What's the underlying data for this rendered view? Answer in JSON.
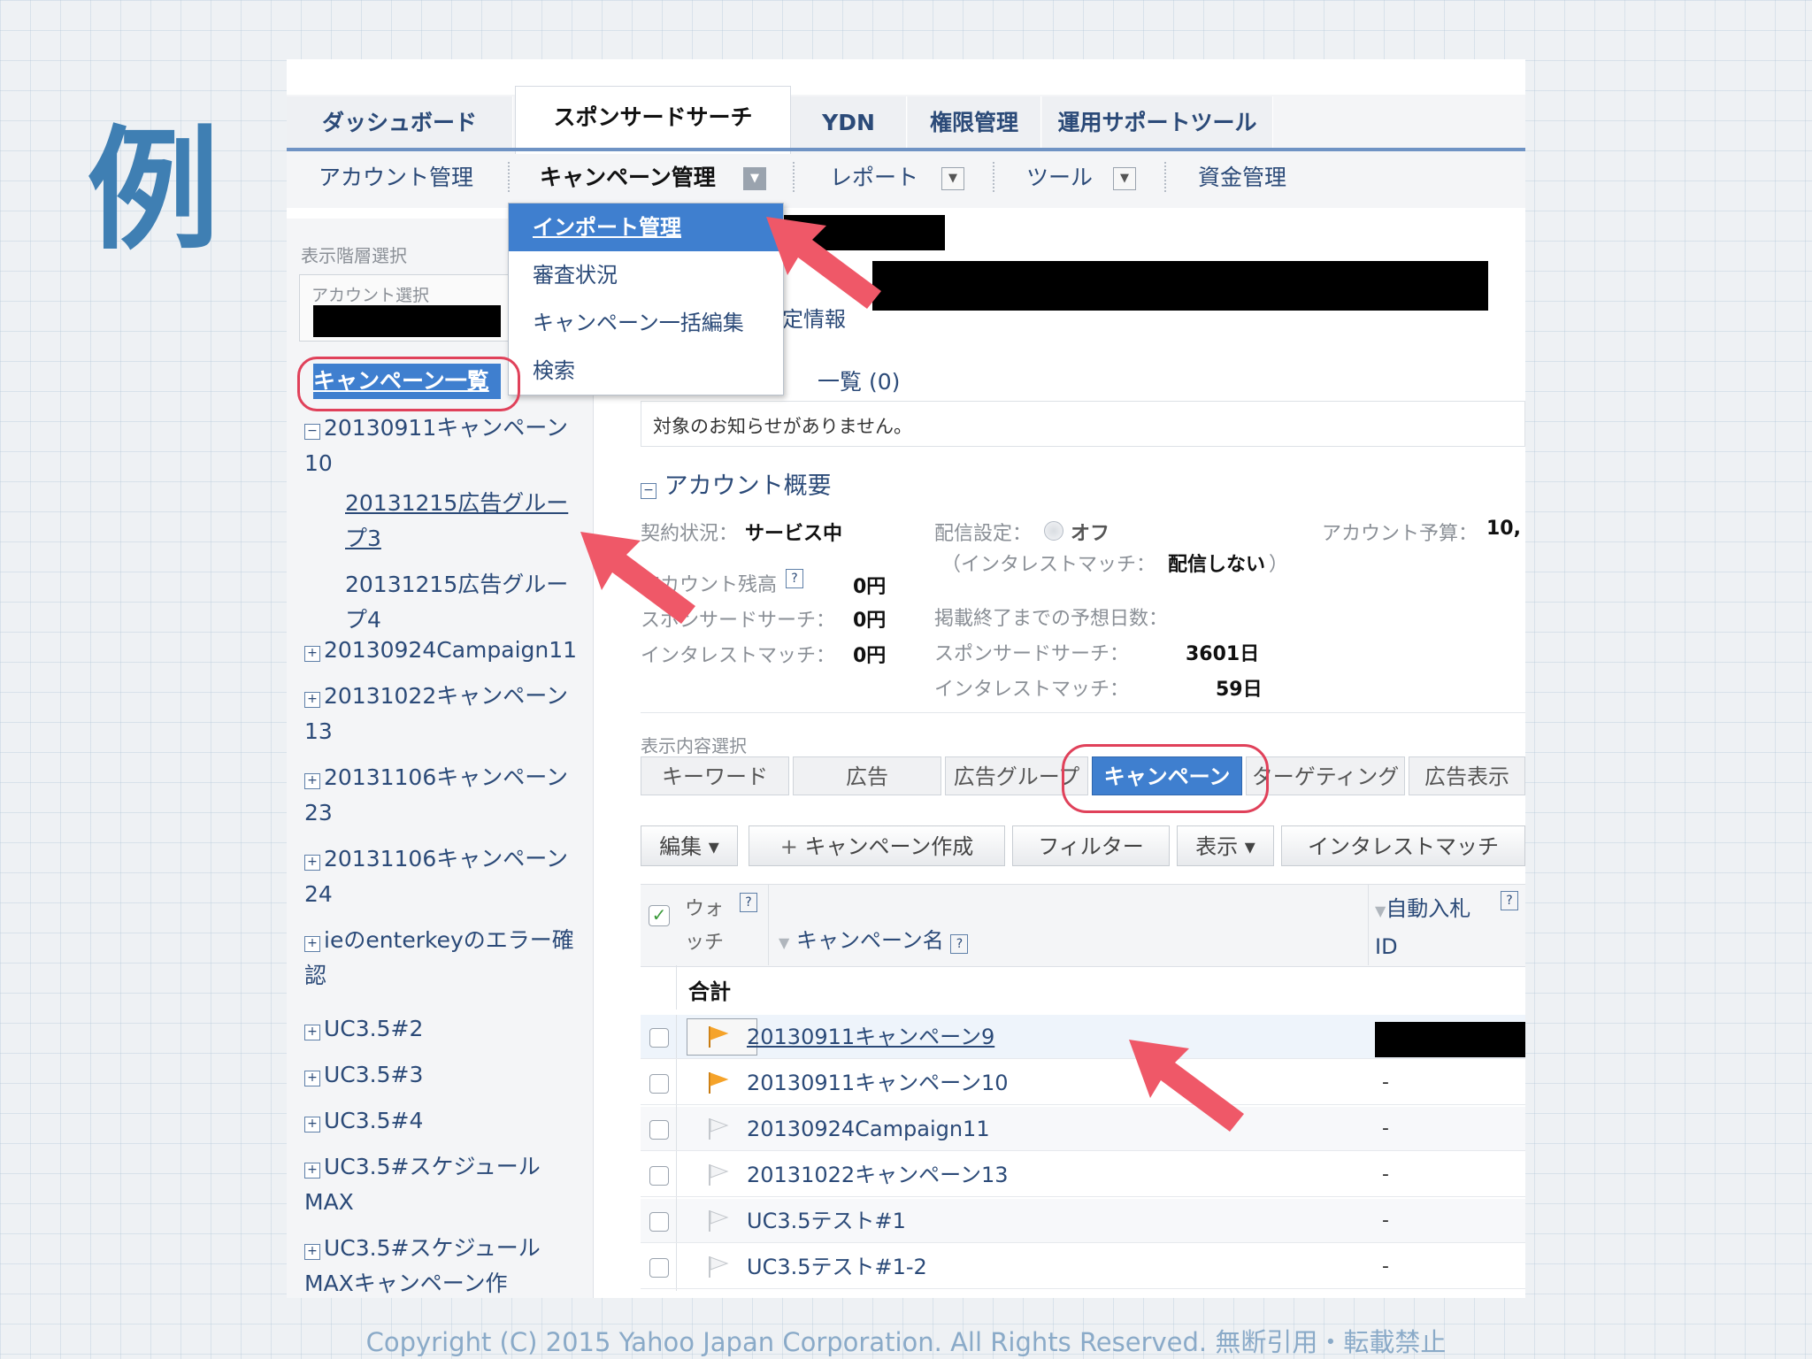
{
  "slide": {
    "title": "例",
    "copyright": "Copyright (C) 2015 Yahoo Japan Corporation. All Rights Reserved. 無断引用・転載禁止"
  },
  "tabs": [
    "ダッシュボード",
    "スポンサードサーチ",
    "YDN",
    "権限管理",
    "運用サポートツール"
  ],
  "subtabs": {
    "account": "アカウント管理",
    "campaign": "キャンペーン管理",
    "report": "レポート",
    "tool": "ツール",
    "funds": "資金管理"
  },
  "menu": [
    "インポート管理",
    "審査状況",
    "キャンペーン一括編集",
    "検索"
  ],
  "left_panel": {
    "hierarchy_label": "表示階層選択",
    "account_select_label": "アカウント選択",
    "campaign_list": "キャンペーン一覧",
    "tree": [
      {
        "label": "20130911キャンペーン10",
        "expanded": true
      },
      {
        "label": "20130924Campaign11"
      },
      {
        "label": "20131022キャンペーン13"
      },
      {
        "label": "20131106キャンペーン23"
      },
      {
        "label": "20131106キャンペーン24"
      },
      {
        "label": "ieのenterkeyのエラー確認"
      },
      {
        "label": "UC3.5#2"
      },
      {
        "label": "UC3.5#3"
      },
      {
        "label": "UC3.5#4"
      },
      {
        "label": "UC3.5#スケジュールMAX"
      },
      {
        "label": "UC3.5#スケジュールMAXキャンペーン作"
      }
    ],
    "adgroups": [
      "20131215広告グループ3",
      "20131215広告グループ4"
    ]
  },
  "notices": {
    "settings_partial": "定情報",
    "list_label": "一覧 (0)",
    "message": "対象のお知らせがありません。"
  },
  "overview": {
    "title": "アカウント概要",
    "contract_label": "契約状況：",
    "contract_value": "サービス中",
    "delivery_label": "配信設定：",
    "delivery_value": "オフ",
    "im_label": "（インタレストマッチ：",
    "im_value": "配信しない",
    "im_close": "）",
    "budget_label": "アカウント予算：",
    "budget_value": "10,",
    "balance_label": "アカウント残高",
    "balance_value": "0円",
    "ss_label": "スポンサードサーチ：",
    "ss_value": "0円",
    "im2_label": "インタレストマッチ：",
    "im2_value": "0円",
    "days_label": "掲載終了までの予想日数：",
    "days_ss_label": "スポンサードサーチ：",
    "days_ss_value": "3601日",
    "days_im_label": "インタレストマッチ：",
    "days_im_value": "59日"
  },
  "content_select": {
    "label": "表示内容選択",
    "buttons": [
      "キーワード",
      "広告",
      "広告グループ",
      "キャンペーン",
      "ターゲティング",
      "広告表示"
    ]
  },
  "toolbar": {
    "edit": "編集",
    "create": "キャンペーン作成",
    "filter": "フィルター",
    "display": "表示",
    "interest": "インタレストマッチ"
  },
  "table": {
    "headers": {
      "watch": "ウォッチ",
      "name": "キャンペーン名",
      "auto_bid": "自動入札ID"
    },
    "total": "合計",
    "rows": [
      {
        "name": "20130911キャンペーン9",
        "flag": "orange",
        "bid": ""
      },
      {
        "name": "20130911キャンペーン10",
        "flag": "orange",
        "bid": "-"
      },
      {
        "name": "20130924Campaign11",
        "flag": "gray",
        "bid": "-"
      },
      {
        "name": "20131022キャンペーン13",
        "flag": "gray",
        "bid": "-"
      },
      {
        "name": "UC3.5テスト#1",
        "flag": "gray",
        "bid": "-"
      },
      {
        "name": "UC3.5テスト#1-2",
        "flag": "gray",
        "bid": "-"
      }
    ]
  },
  "colors": {
    "accent": "#3f7fcf",
    "annotation": "#e0415a",
    "flag_orange": "#f5a32a"
  }
}
